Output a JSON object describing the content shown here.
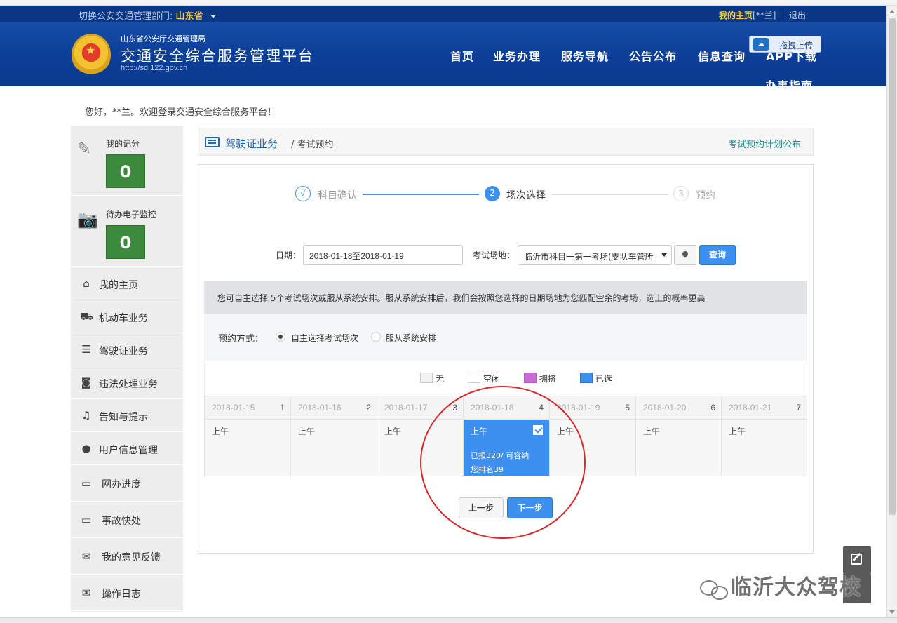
{
  "header": {
    "switch_label": "切换公安交通管理部门:",
    "province": "山东省",
    "my_home": "我的主页",
    "user_masked": "[**兰]",
    "logout": "退出",
    "org_name": "山东省公安厅交通管理局",
    "platform_title": "交通安全综合服务管理平台",
    "url": "http://sd.122.gov.cn",
    "upload_label": "拖拽上传",
    "nav": [
      "首页",
      "业务办理",
      "服务导航",
      "公告公布",
      "信息查询",
      "APP下载",
      "办事指南"
    ]
  },
  "welcome": "您好，**兰。欢迎登录交通安全综合服务平台！",
  "sidebar": {
    "score_label": "我的记分",
    "score_value": "0",
    "monitor_label": "待办电子监控",
    "monitor_value": "0",
    "items": [
      {
        "label": "我的主页",
        "icon": "home-icon"
      },
      {
        "label": "机动车业务",
        "icon": "truck-icon"
      },
      {
        "label": "驾驶证业务",
        "icon": "list-icon"
      },
      {
        "label": "违法处理业务",
        "icon": "camera-icon"
      },
      {
        "label": "告知与提示",
        "icon": "bell-icon"
      },
      {
        "label": "用户信息管理",
        "icon": "user-icon"
      },
      {
        "label": "网办进度",
        "icon": "progress-icon"
      },
      {
        "label": "事故快处",
        "icon": "accident-icon"
      },
      {
        "label": "我的意见反馈",
        "icon": "feedback-icon"
      },
      {
        "label": "操作日志",
        "icon": "log-icon"
      }
    ]
  },
  "breadcrumb": {
    "section": "驾驶证业务",
    "page": "/ 考试预约",
    "plan_link": "考试预约计划公布"
  },
  "steps": [
    {
      "num": "√",
      "label": "科目确认",
      "state": "done"
    },
    {
      "num": "2",
      "label": "场次选择",
      "state": "active"
    },
    {
      "num": "3",
      "label": "预约",
      "state": "pending"
    }
  ],
  "search": {
    "date_label": "日期：",
    "date_value": "2018-01-18至2018-01-19",
    "site_label": "考试场地：",
    "site_value": "临沂市科目一第一考场(支队车管所",
    "query_label": "查询"
  },
  "notice": "您可自主选择 5个考试场次或服从系统安排。服从系统安排后，我们会按照您选择的日期场地为您匹配空余的考场，选上的概率更高",
  "mode": {
    "label": "预约方式：",
    "options": [
      "自主选择考试场次",
      "服从系统安排"
    ],
    "selected": "自主选择考试场次"
  },
  "legend": [
    {
      "label": "无",
      "color": "#f2f2f2"
    },
    {
      "label": "空闲",
      "color": "#ffffff"
    },
    {
      "label": "拥挤",
      "color": "#c86bd6"
    },
    {
      "label": "已选",
      "color": "#3d8ff0"
    }
  ],
  "calendar": [
    {
      "date": "2018-01-15",
      "num": "1",
      "session": "上午"
    },
    {
      "date": "2018-01-16",
      "num": "2",
      "session": "上午"
    },
    {
      "date": "2018-01-17",
      "num": "3",
      "session": "上午"
    },
    {
      "date": "2018-01-18",
      "num": "4",
      "session": "上午",
      "selected": true,
      "info1": "已报320/ 可容纳",
      "info2": "您排名39"
    },
    {
      "date": "2018-01-19",
      "num": "5",
      "session": "上午"
    },
    {
      "date": "2018-01-20",
      "num": "6",
      "session": "上午"
    },
    {
      "date": "2018-01-21",
      "num": "7",
      "session": "上午"
    }
  ],
  "buttons": {
    "prev": "上一步",
    "next": "下一步"
  },
  "watermark": "临沂大众驾校"
}
